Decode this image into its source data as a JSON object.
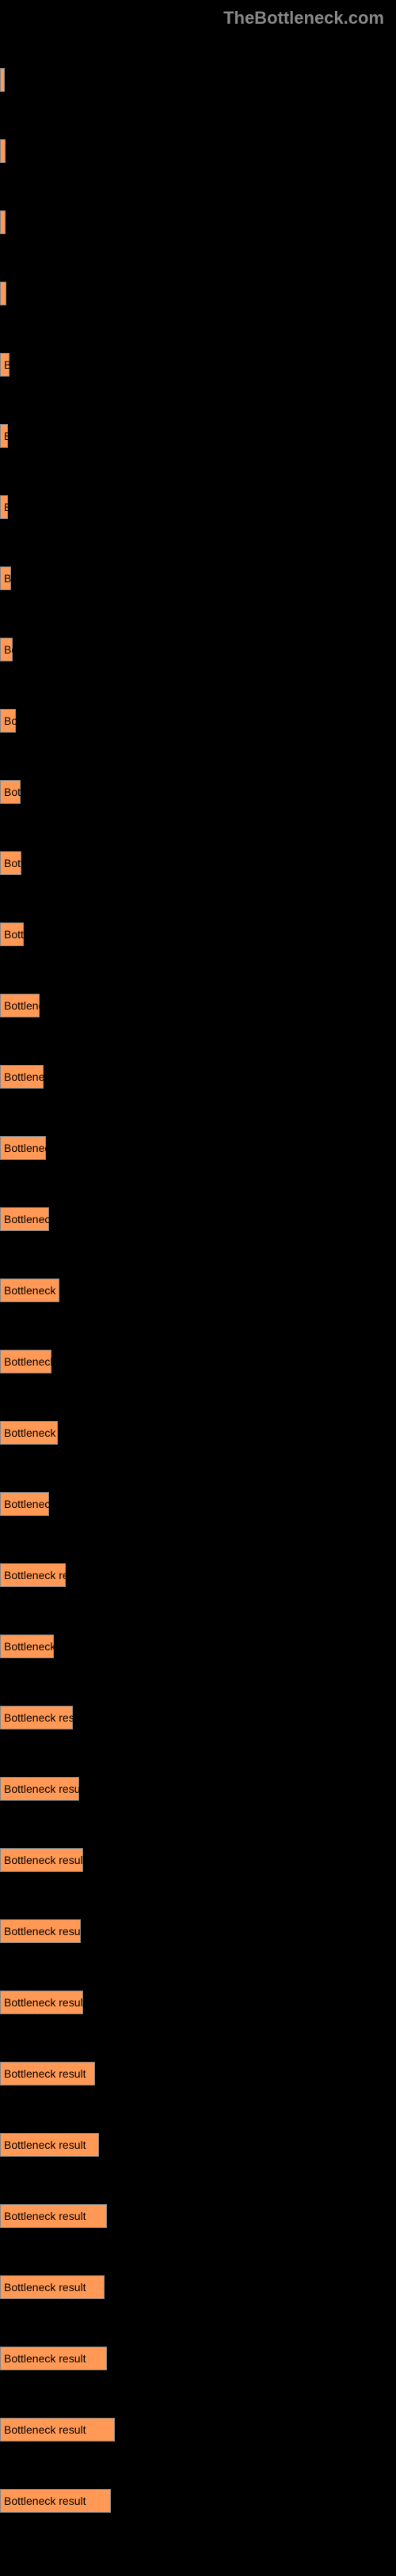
{
  "site_title": "TheBottleneck.com",
  "chart_data": {
    "type": "bar",
    "title": "",
    "xlabel": "",
    "ylabel": "",
    "xlim": [
      0,
      500
    ],
    "bar_label": "Bottleneck result",
    "bars": [
      {
        "width": 2,
        "label": ""
      },
      {
        "width": 7,
        "label": ""
      },
      {
        "width": 7,
        "label": ""
      },
      {
        "width": 8,
        "label": ""
      },
      {
        "width": 12,
        "label": "B"
      },
      {
        "width": 10,
        "label": "B"
      },
      {
        "width": 10,
        "label": "B"
      },
      {
        "width": 14,
        "label": "B"
      },
      {
        "width": 16,
        "label": "Bo"
      },
      {
        "width": 20,
        "label": "Bo"
      },
      {
        "width": 26,
        "label": "Bott"
      },
      {
        "width": 27,
        "label": "Bott"
      },
      {
        "width": 30,
        "label": "Bottl"
      },
      {
        "width": 50,
        "label": "Bottlenec"
      },
      {
        "width": 55,
        "label": "Bottleneck re"
      },
      {
        "width": 58,
        "label": "Bottleneck"
      },
      {
        "width": 62,
        "label": "Bottleneck resu"
      },
      {
        "width": 75,
        "label": "Bottleneck result"
      },
      {
        "width": 65,
        "label": "Bottleneck res"
      },
      {
        "width": 73,
        "label": "Bottleneck resul"
      },
      {
        "width": 62,
        "label": "Bottleneck re"
      },
      {
        "width": 83,
        "label": "Bottleneck result"
      },
      {
        "width": 68,
        "label": "Bottleneck resu"
      },
      {
        "width": 92,
        "label": "Bottleneck result"
      },
      {
        "width": 100,
        "label": "Bottleneck result"
      },
      {
        "width": 105,
        "label": "Bottleneck result"
      },
      {
        "width": 102,
        "label": "Bottleneck result"
      },
      {
        "width": 105,
        "label": "Bottleneck result"
      },
      {
        "width": 120,
        "label": "Bottleneck result"
      },
      {
        "width": 125,
        "label": "Bottleneck result"
      },
      {
        "width": 135,
        "label": "Bottleneck result"
      },
      {
        "width": 132,
        "label": "Bottleneck result"
      },
      {
        "width": 135,
        "label": "Bottleneck result"
      },
      {
        "width": 145,
        "label": "Bottleneck result"
      },
      {
        "width": 140,
        "label": "Bottleneck result"
      }
    ]
  }
}
